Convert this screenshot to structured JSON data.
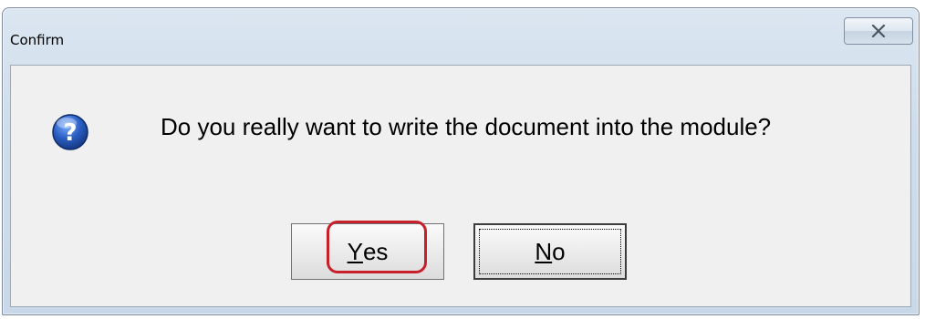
{
  "dialog": {
    "title": "Confirm",
    "close_icon": "close-icon",
    "message": "Do you really want to write the document into the module?",
    "icon": "question-icon",
    "buttons": {
      "yes": {
        "accel": "Y",
        "rest": "es"
      },
      "no": {
        "accel": "N",
        "rest": "o"
      }
    }
  },
  "colors": {
    "highlight": "#c8202a",
    "icon_blue": "#1f4fa8"
  }
}
